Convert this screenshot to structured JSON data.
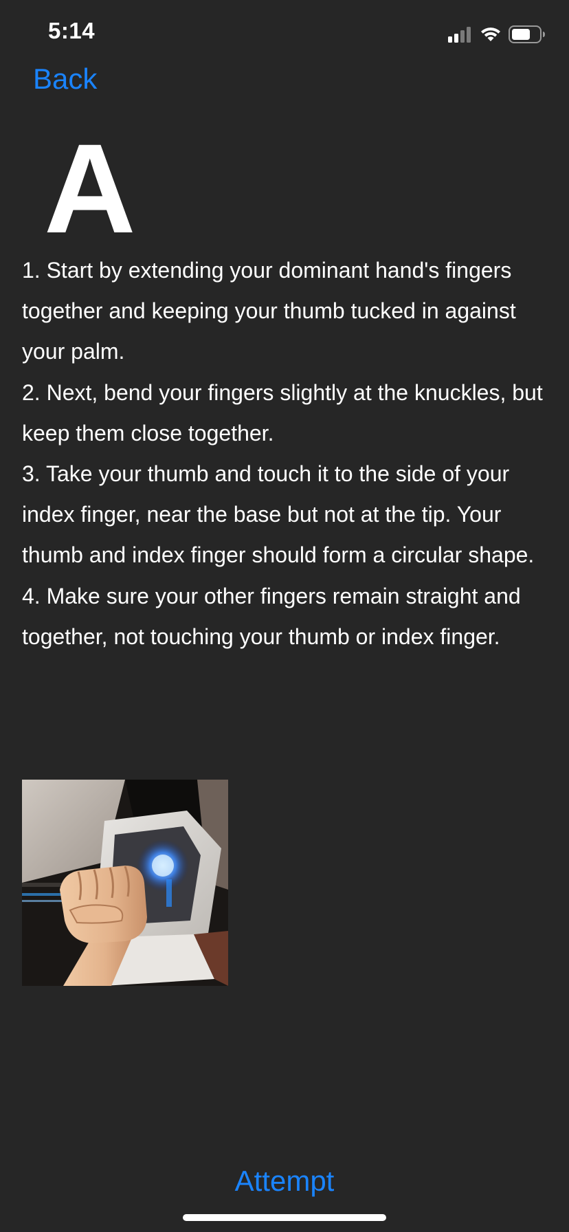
{
  "status_bar": {
    "time": "5:14",
    "icons": [
      "cellular-signal-icon",
      "wifi-icon",
      "battery-icon"
    ]
  },
  "nav": {
    "back_label": "Back"
  },
  "lesson": {
    "letter": "A",
    "steps": [
      "1. Start by extending your dominant hand's fingers together and keeping your thumb tucked in against your palm.",
      "2. Next, bend your fingers slightly at the knuckles, but keep them close together.",
      "3. Take your thumb and touch it to the side of your index finger, near the base but not at the tip. Your thumb and index finger should form a circular shape.",
      "4. Make sure your other fingers remain straight and together, not touching your thumb or index finger."
    ]
  },
  "actions": {
    "attempt_label": "Attempt"
  },
  "colors": {
    "background": "#262626",
    "accent": "#1a84ff",
    "text": "#ffffff"
  }
}
